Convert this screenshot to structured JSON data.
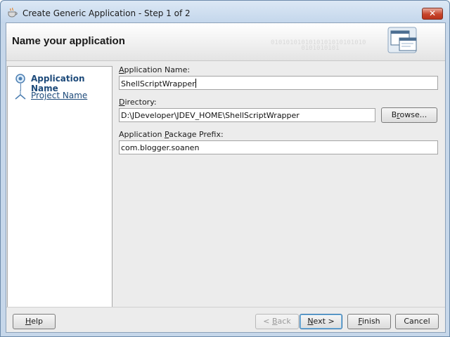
{
  "window": {
    "title": "Create Generic Application - Step 1 of 2",
    "close_label": "✕"
  },
  "header": {
    "title": "Name your application",
    "binary_watermark": "0101010101010101010101010\n        0101010101"
  },
  "steps": [
    {
      "label": "Application Name",
      "state": "current"
    },
    {
      "label": "Project Name",
      "state": "link"
    }
  ],
  "form": {
    "app_name": {
      "label_mn": "A",
      "label_rest": "pplication Name:",
      "value": "ShellScriptWrapper"
    },
    "directory": {
      "label_mn": "D",
      "label_rest": "irectory:",
      "value": "D:\\JDeveloper\\JDEV_HOME\\ShellScriptWrapper"
    },
    "browse": {
      "pre": "B",
      "mn": "r",
      "post": "owse..."
    },
    "package_prefix": {
      "label_pre": "Application ",
      "label_mn": "P",
      "label_rest": "ackage Prefix:",
      "value": "com.blogger.soanen"
    }
  },
  "footer": {
    "help": {
      "pre": "",
      "mn": "H",
      "post": "elp"
    },
    "back": {
      "pre": "< ",
      "mn": "B",
      "post": "ack",
      "enabled": false
    },
    "next": {
      "pre": "",
      "mn": "N",
      "post": "ext >"
    },
    "finish": {
      "pre": "",
      "mn": "F",
      "post": "inish"
    },
    "cancel": {
      "label": "Cancel"
    }
  },
  "colors": {
    "accent": "#1d4a7a",
    "close_red": "#c7452b"
  }
}
